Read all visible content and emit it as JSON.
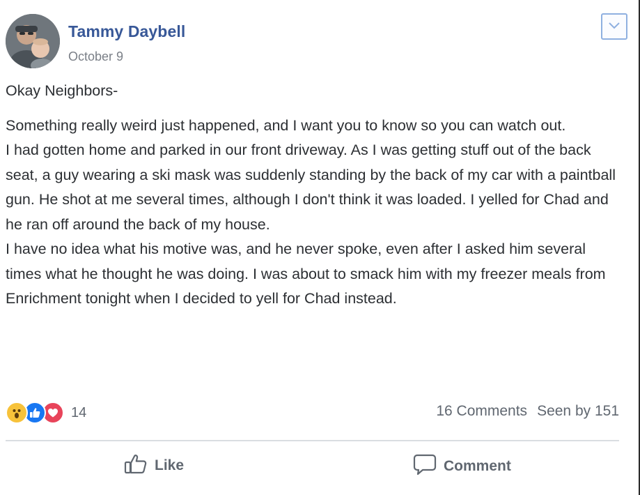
{
  "post": {
    "author": "Tammy Daybell",
    "date": "October 9",
    "greeting": "Okay Neighbors-",
    "paragraphs": [
      "Something really weird just happened, and I want you to know so you can watch out.",
      "I had gotten home and parked in our front driveway. As I was getting stuff out of the back seat, a guy wearing a ski mask was suddenly standing by the back of my car with a paintball gun. He shot at me several times, although I don't think it was loaded. I yelled for Chad and he ran off around the back of my house.",
      "I have no idea what his motive was, and he never spoke, even after I asked him several times what he thought he was doing. I was about to smack him with my freezer meals from Enrichment tonight when I decided to yell for Chad instead."
    ],
    "reactions": {
      "icons": [
        "wow-reaction-icon",
        "like-reaction-icon",
        "love-reaction-icon"
      ],
      "count": "14"
    },
    "stats": {
      "comments": "16 Comments",
      "seen": "Seen by 151"
    },
    "actions": {
      "like_label": "Like",
      "comment_label": "Comment"
    }
  },
  "colors": {
    "author": "#385898",
    "muted": "#606770",
    "divider": "#dadde1",
    "menu_border": "#8fb0e0"
  }
}
